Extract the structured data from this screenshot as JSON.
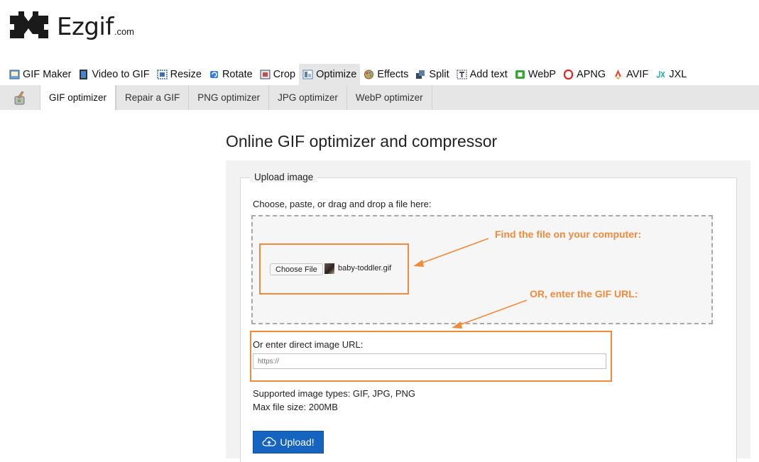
{
  "brand": {
    "name": "Ezgif",
    "domain": ".com"
  },
  "main_nav": [
    {
      "label": "GIF Maker",
      "icon": "gif-maker-icon"
    },
    {
      "label": "Video to GIF",
      "icon": "video-to-gif-icon"
    },
    {
      "label": "Resize",
      "icon": "resize-icon"
    },
    {
      "label": "Rotate",
      "icon": "rotate-icon"
    },
    {
      "label": "Crop",
      "icon": "crop-icon"
    },
    {
      "label": "Optimize",
      "icon": "optimize-icon",
      "active": true
    },
    {
      "label": "Effects",
      "icon": "effects-icon"
    },
    {
      "label": "Split",
      "icon": "split-icon"
    },
    {
      "label": "Add text",
      "icon": "add-text-icon"
    },
    {
      "label": "WebP",
      "icon": "webp-icon"
    },
    {
      "label": "APNG",
      "icon": "apng-icon"
    },
    {
      "label": "AVIF",
      "icon": "avif-icon"
    },
    {
      "label": "JXL",
      "icon": "jxl-icon"
    }
  ],
  "sub_nav": [
    {
      "label": "GIF optimizer",
      "active": true
    },
    {
      "label": "Repair a GIF"
    },
    {
      "label": "PNG optimizer"
    },
    {
      "label": "JPG optimizer"
    },
    {
      "label": "WebP optimizer"
    }
  ],
  "page": {
    "title": "Online GIF optimizer and compressor"
  },
  "upload": {
    "legend": "Upload image",
    "choose_label": "Choose, paste, or drag and drop a file here:",
    "choose_button": "Choose File",
    "file_name": "baby-toddler.gif",
    "url_label": "Or enter direct image URL:",
    "url_placeholder": "https://",
    "supported": "Supported image types: GIF, JPG, PNG",
    "max_size": "Max file size: 200MB",
    "upload_button": "Upload!"
  },
  "annotations": {
    "find_file": "Find the file on your computer:",
    "enter_url": "OR, enter the GIF URL:"
  },
  "colors": {
    "annotation": "#f08a3c",
    "upload_button": "#1565c0",
    "nav_bar": "#e6e6e6"
  }
}
